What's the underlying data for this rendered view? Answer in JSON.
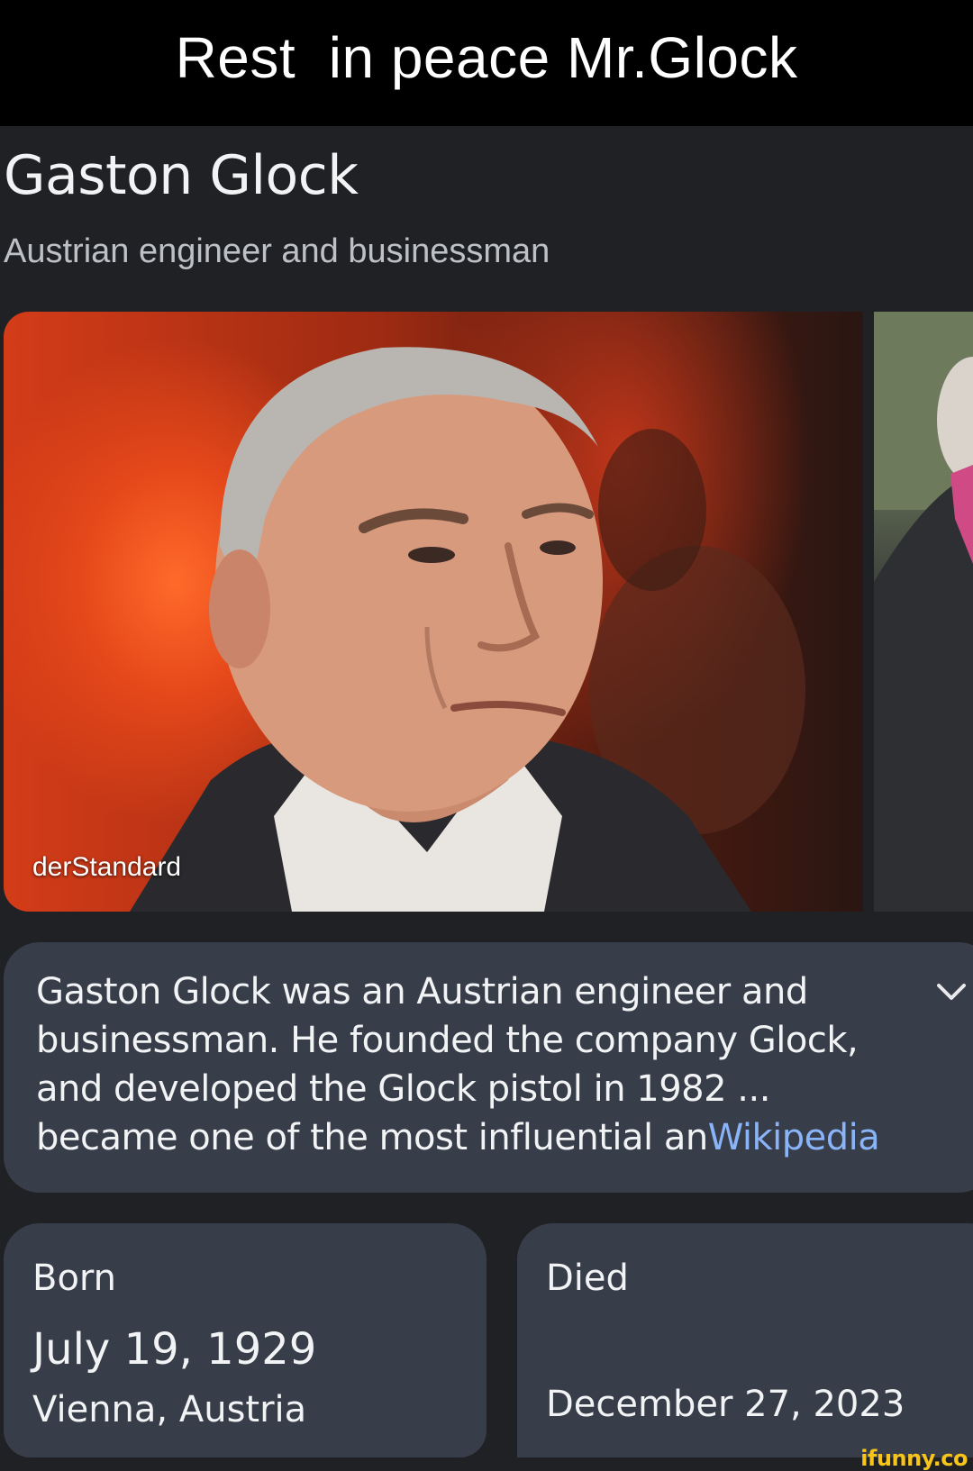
{
  "caption": {
    "text": "Rest  in peace Mr.Glock"
  },
  "knowledge_panel": {
    "title": "Gaston Glock",
    "subtitle": "Austrian engineer and businessman",
    "image": {
      "source_label": "derStandard"
    },
    "summary": {
      "text": "Gaston Glock was an Austrian engineer and businessman. He founded the company Glock, and developed the Glock pistol in 1982 ... became one of the most influential an",
      "source_link": "Wikipedia",
      "expand_icon": "chevron-down-icon"
    },
    "facts": {
      "born": {
        "label": "Born",
        "date": "July 19, 1929",
        "place": "Vienna, Austria"
      },
      "died": {
        "label": "Died",
        "date": "December 27, 2023"
      }
    }
  },
  "watermark": {
    "text": "ifunny.co"
  },
  "colors": {
    "caption_bg": "#000000",
    "page_bg": "#202124",
    "card_bg": "#383d4a",
    "link": "#8ab4f8",
    "watermark": "#f7c41b"
  }
}
